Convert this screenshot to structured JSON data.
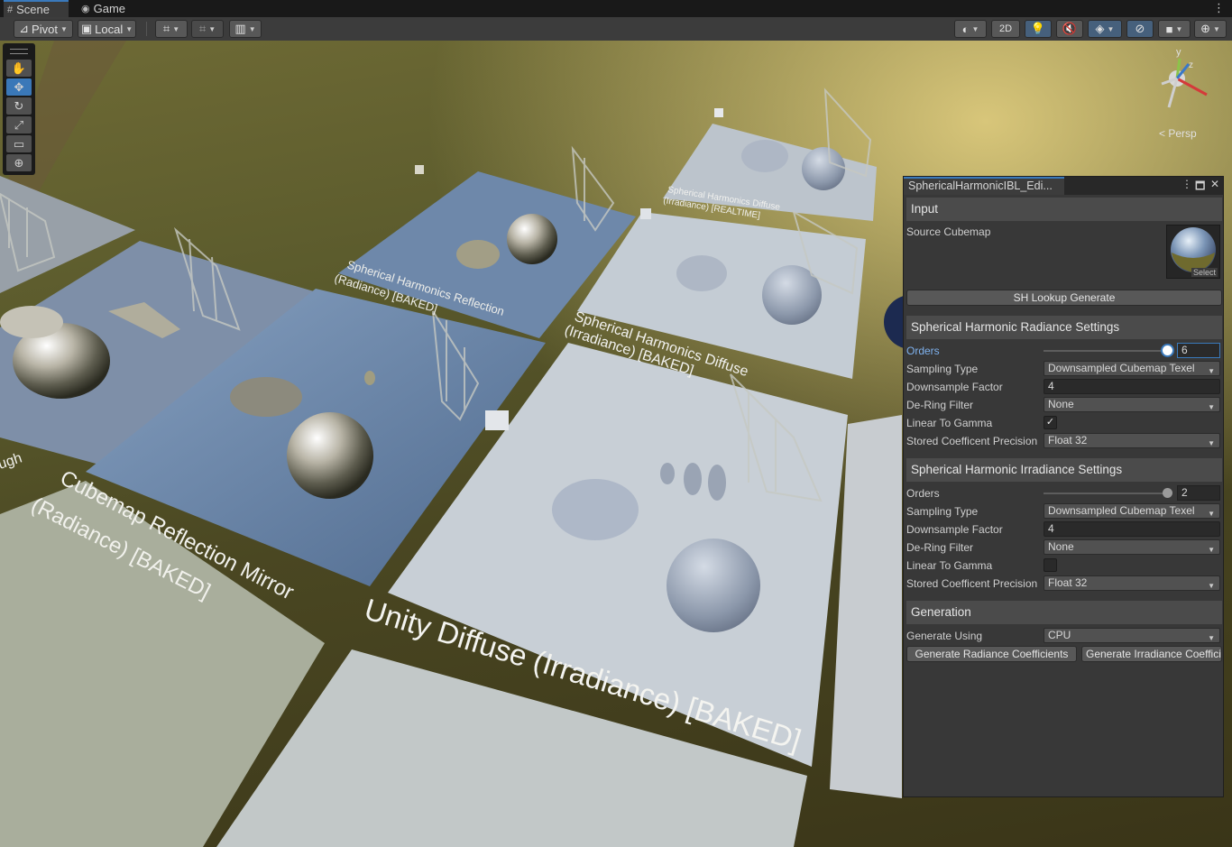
{
  "tabs": {
    "scene": "Scene",
    "game": "Game"
  },
  "toolbar": {
    "pivot": "Pivot",
    "local": "Local",
    "mode_2d": "2D"
  },
  "scene": {
    "labels": {
      "cubemap_reflection": "Cubemap Reflection Mirror",
      "cubemap_reflection_sub": "(Radiance) [BAKED]",
      "sh_reflection": "Spherical Harmonics Reflection",
      "sh_reflection_sub": "(Radiance) [BAKED]",
      "sh_diffuse": "Spherical Harmonics Diffuse",
      "sh_diffuse_sub": "(Irradiance) [BAKED]",
      "sh_diffuse_rt": "Spherical Harmonics Diffuse",
      "sh_diffuse_rt_sub": "(Irradiance) [REALTIME]",
      "unity_diffuse": "Unity Diffuse (Irradiance) [BAKED]",
      "partial_left": "ugh"
    },
    "gizmo": {
      "y": "y",
      "z": "z",
      "persp": "< Persp"
    }
  },
  "panel": {
    "title": "SphericalHarmonicIBL_Edi...",
    "input": {
      "header": "Input",
      "source_cubemap_label": "Source Cubemap",
      "select_label": "Select",
      "sh_lookup_button": "SH Lookup Generate"
    },
    "radiance": {
      "header": "Spherical Harmonic Radiance Settings",
      "orders_label": "Orders",
      "orders_value": "6",
      "orders_fraction": 1.0,
      "sampling_label": "Sampling Type",
      "sampling_value": "Downsampled Cubemap Texel",
      "downsample_label": "Downsample Factor",
      "downsample_value": "4",
      "dering_label": "De-Ring Filter",
      "dering_value": "None",
      "linear_label": "Linear To Gamma",
      "linear_checked": true,
      "precision_label": "Stored Coefficent Precision",
      "precision_value": "Float 32"
    },
    "irradiance": {
      "header": "Spherical Harmonic Irradiance Settings",
      "orders_label": "Orders",
      "orders_value": "2",
      "orders_fraction": 1.0,
      "sampling_label": "Sampling Type",
      "sampling_value": "Downsampled Cubemap Texel",
      "downsample_label": "Downsample Factor",
      "downsample_value": "4",
      "dering_label": "De-Ring Filter",
      "dering_value": "None",
      "linear_label": "Linear To Gamma",
      "linear_checked": false,
      "precision_label": "Stored Coefficent Precision",
      "precision_value": "Float 32"
    },
    "generation": {
      "header": "Generation",
      "using_label": "Generate Using",
      "using_value": "CPU",
      "radiance_button": "Generate Radiance Coefficients",
      "irradiance_button": "Generate Irradiance Coefficients"
    }
  },
  "colors": {
    "accent": "#3a79bb",
    "panel_bg": "#383838",
    "header_bg": "#4b4b4b"
  }
}
